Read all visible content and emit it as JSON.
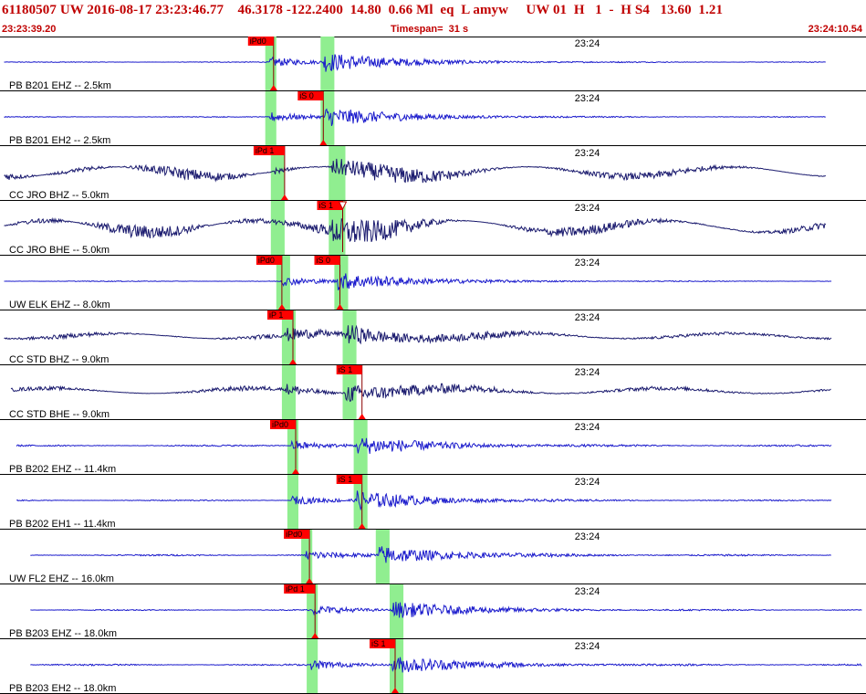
{
  "header": {
    "title": "61180507 UW 2016-08-17 23:23:46.77    46.3178 -122.2400  14.80  0.66 Ml  eq  L amyw     UW 01  H   1  -  H S4   13.60  1.21",
    "start_time": "23:23:39.20",
    "timespan": "Timespan=  31 s",
    "end_time": "23:24:10.54"
  },
  "colors": {
    "header_text": "#c00000",
    "trace_blue": "#1a1acc",
    "trace_navy": "#1a1a6e",
    "pick_flag": "#ff0000",
    "pick_window": "#90ee90",
    "separator": "#000000"
  },
  "chart_data": {
    "type": "line",
    "x_unit": "s",
    "xlim": [
      0,
      31.34
    ],
    "tick_label": "23:24",
    "tick_time": 20.8,
    "channels": [
      {
        "label": "PB B201 EHZ -- 2.5km",
        "color": "blue",
        "noise": 0.02,
        "amp": 0.45,
        "start": 0.15,
        "end": 29.9,
        "picks": [
          {
            "label": "iPd0",
            "t": 9.9,
            "kind": "flag"
          }
        ],
        "windows": [
          [
            9.6,
            10.0
          ],
          [
            11.6,
            12.1
          ]
        ]
      },
      {
        "label": "PB B201 EH2 -- 2.5km",
        "color": "blue",
        "noise": 0.02,
        "amp": 0.45,
        "start": 0.15,
        "end": 29.9,
        "picks": [
          {
            "label": "iS 0",
            "t": 11.7,
            "kind": "flag"
          }
        ],
        "windows": [
          [
            9.6,
            10.0
          ],
          [
            11.6,
            12.1
          ]
        ]
      },
      {
        "label": "CC JRO BHZ -- 5.0km",
        "color": "navy",
        "noise": 0.15,
        "amp": 0.4,
        "start": 0.15,
        "end": 29.9,
        "picks": [
          {
            "label": "iPd 1",
            "t": 10.3,
            "kind": "flag"
          }
        ],
        "windows": [
          [
            9.8,
            10.3
          ],
          [
            11.9,
            12.5
          ]
        ]
      },
      {
        "label": "CC JRO BHE -- 5.0km",
        "color": "navy",
        "noise": 0.18,
        "amp": 0.4,
        "start": 0.15,
        "end": 29.9,
        "picks": [
          {
            "label": "iS 1",
            "t": 12.4,
            "kind": "hollow"
          }
        ],
        "windows": [
          [
            9.8,
            10.3
          ],
          [
            11.9,
            12.5
          ]
        ]
      },
      {
        "label": "UW ELK EHZ -- 8.0km",
        "color": "blue",
        "noise": 0.02,
        "amp": 0.4,
        "start": 0.15,
        "end": 30.1,
        "picks": [
          {
            "label": "iPd0",
            "t": 10.2,
            "kind": "flag"
          },
          {
            "label": "iS 0",
            "t": 12.3,
            "kind": "flag"
          }
        ],
        "windows": [
          [
            10.0,
            10.5
          ],
          [
            12.1,
            12.6
          ]
        ]
      },
      {
        "label": "CC STD BHZ -- 9.0km",
        "color": "navy",
        "noise": 0.08,
        "amp": 0.45,
        "start": 0.15,
        "end": 30.1,
        "picks": [
          {
            "label": "iP 1",
            "t": 10.6,
            "kind": "flag"
          }
        ],
        "windows": [
          [
            10.2,
            10.7
          ],
          [
            12.4,
            12.9
          ]
        ]
      },
      {
        "label": "CC STD BHE -- 9.0km",
        "color": "navy",
        "noise": 0.08,
        "amp": 0.45,
        "start": 0.4,
        "end": 30.1,
        "picks": [
          {
            "label": "iS 1",
            "t": 13.1,
            "kind": "flag"
          }
        ],
        "windows": [
          [
            10.2,
            10.7
          ],
          [
            12.4,
            12.9
          ]
        ]
      },
      {
        "label": "PB B202 EHZ -- 11.4km",
        "color": "blue",
        "noise": 0.04,
        "amp": 0.42,
        "start": 0.6,
        "end": 30.1,
        "picks": [
          {
            "label": "iPd0",
            "t": 10.7,
            "kind": "flag"
          }
        ],
        "windows": [
          [
            10.4,
            10.8
          ],
          [
            12.8,
            13.3
          ]
        ]
      },
      {
        "label": "PB B202 EH1 -- 11.4km",
        "color": "blue",
        "noise": 0.03,
        "amp": 0.42,
        "start": 0.6,
        "end": 30.1,
        "picks": [
          {
            "label": "iS 1",
            "t": 13.1,
            "kind": "flag"
          }
        ],
        "windows": [
          [
            10.4,
            10.8
          ],
          [
            12.8,
            13.3
          ]
        ]
      },
      {
        "label": "UW FL2 EHZ -- 16.0km",
        "color": "blue",
        "noise": 0.04,
        "amp": 0.42,
        "start": 1.1,
        "end": 30.1,
        "picks": [
          {
            "label": "iPd0",
            "t": 11.2,
            "kind": "flag"
          }
        ],
        "windows": [
          [
            10.9,
            11.3
          ],
          [
            13.6,
            14.1
          ]
        ]
      },
      {
        "label": "PB B203 EHZ -- 18.0km",
        "color": "blue",
        "noise": 0.03,
        "amp": 0.42,
        "start": 1.1,
        "end": 31.2,
        "picks": [
          {
            "label": "iPd 1",
            "t": 11.4,
            "kind": "flag"
          }
        ],
        "windows": [
          [
            11.1,
            11.5
          ],
          [
            14.1,
            14.6
          ]
        ]
      },
      {
        "label": "PB B203 EH2 -- 18.0km",
        "color": "blue",
        "noise": 0.04,
        "amp": 0.42,
        "start": 1.1,
        "end": 31.2,
        "picks": [
          {
            "label": "iS 1",
            "t": 14.3,
            "kind": "flag"
          }
        ],
        "windows": [
          [
            11.1,
            11.5
          ],
          [
            14.1,
            14.6
          ]
        ]
      }
    ]
  }
}
